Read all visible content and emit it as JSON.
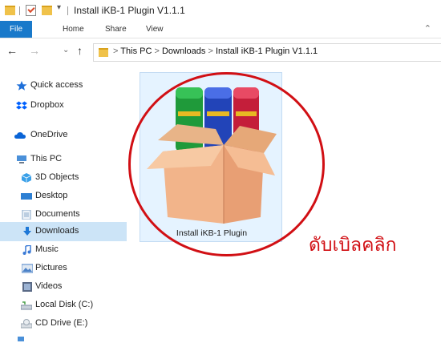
{
  "window": {
    "title": "Install iKB-1 Plugin V1.1.1"
  },
  "ribbon": {
    "tabs": [
      "File",
      "Home",
      "Share",
      "View"
    ]
  },
  "address": {
    "path": [
      "This PC",
      "Downloads",
      "Install iKB-1 Plugin V1.1.1"
    ]
  },
  "sidebar": {
    "items": [
      {
        "label": "Quick access",
        "icon": "star-icon",
        "color": "#1e6fd9"
      },
      {
        "label": "Dropbox",
        "icon": "dropbox-icon",
        "color": "#0061fe"
      },
      {
        "label": "OneDrive",
        "icon": "cloud-icon",
        "color": "#0a64d6"
      },
      {
        "label": "This PC",
        "icon": "computer-icon",
        "color": "#4a90d9"
      },
      {
        "label": "3D Objects",
        "icon": "cube-icon",
        "color": "#3aa0e8"
      },
      {
        "label": "Desktop",
        "icon": "desktop-icon",
        "color": "#2d7fd3"
      },
      {
        "label": "Documents",
        "icon": "document-icon",
        "color": "#8aa9c9"
      },
      {
        "label": "Downloads",
        "icon": "download-icon",
        "color": "#1e78d7"
      },
      {
        "label": "Music",
        "icon": "music-icon",
        "color": "#3a7ad6"
      },
      {
        "label": "Pictures",
        "icon": "pictures-icon",
        "color": "#4b82c8"
      },
      {
        "label": "Videos",
        "icon": "video-icon",
        "color": "#5a6a86"
      },
      {
        "label": "Local Disk (C:)",
        "icon": "disk-icon",
        "color": "#7a8aa0"
      },
      {
        "label": "CD Drive (E:)",
        "icon": "cd-icon",
        "color": "#9aa6b2"
      }
    ],
    "selected": "Downloads"
  },
  "file": {
    "name": "Install iKB-1 Plugin"
  },
  "annotation": {
    "text": "ดับเบิลคลิก",
    "color": "#d10f14"
  }
}
